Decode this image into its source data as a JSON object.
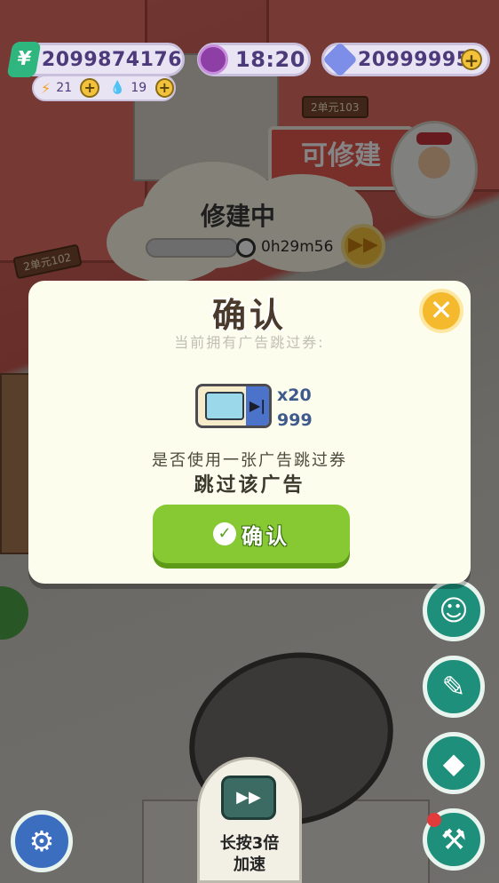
{
  "hud": {
    "cash": "2099874176",
    "time": "18:20",
    "gems": "20999995",
    "energy": "21",
    "water": "19"
  },
  "scene": {
    "unit_103_tag": "2单元103",
    "unit_102_tag": "2单元102",
    "repairable_sign": "可修建",
    "building_status": "修建中",
    "timer": "0h29m56",
    "speedup_line1": "长按3倍",
    "speedup_line2": "加速"
  },
  "dialog": {
    "title": "确认",
    "subtitle": "当前拥有广告跳过券:",
    "ticket_multiplier": "x20",
    "ticket_count": "999",
    "question_line1": "是否使用一张广告跳过券",
    "question_line2": "跳过该广告",
    "confirm_label": "确认"
  },
  "colors": {
    "accent_green": "#86c933",
    "close_yellow": "#f5b92e",
    "side_teal": "#1d8f7a"
  }
}
